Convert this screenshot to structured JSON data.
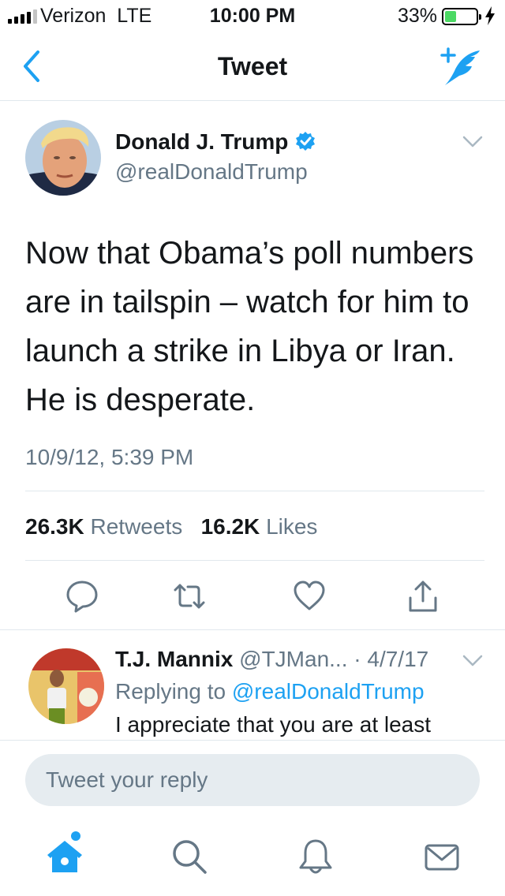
{
  "status_bar": {
    "carrier": "Verizon  LTE",
    "time": "10:00 PM",
    "battery": "33%",
    "battery_level": 0.33
  },
  "nav": {
    "title": "Tweet",
    "back_icon": "chevron-left-icon",
    "compose_icon": "compose-tweet-icon"
  },
  "tweet": {
    "author_name": "Donald J. Trump",
    "author_handle": "@realDonaldTrump",
    "verified": true,
    "text": "Now that Obama’s poll numbers are in tailspin – watch for him to launch a strike in Libya or Iran. He is desperate.",
    "timestamp": "10/9/12, 5:39 PM",
    "retweets_count": "26.3K",
    "retweets_label": "Retweets",
    "likes_count": "16.2K",
    "likes_label": "Likes"
  },
  "reply": {
    "author_name": "T.J. Mannix",
    "author_handle": "@TJMan...",
    "date": "· 4/7/17",
    "replying_prefix": "Replying to",
    "replying_to": "@realDonaldTrump",
    "text": "I appreciate that you are at least"
  },
  "composer": {
    "placeholder": "Tweet your reply"
  },
  "tab_bar": {
    "items": [
      "home-icon",
      "search-icon",
      "notifications-icon",
      "messages-icon"
    ]
  },
  "colors": {
    "accent": "#1da1f2",
    "text": "#14171a",
    "secondary_text": "#657786",
    "divider": "#e1e8ed"
  }
}
